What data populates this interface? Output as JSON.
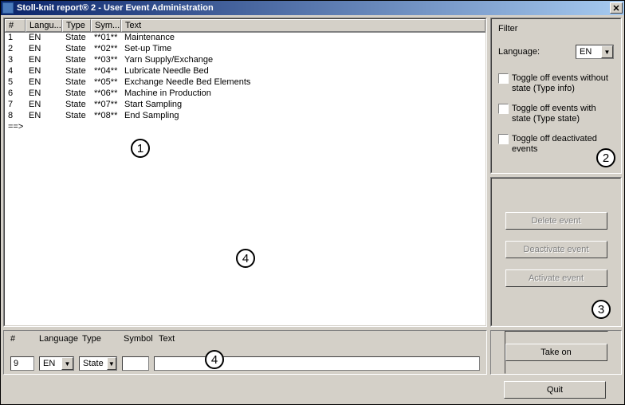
{
  "title": "Stoll-knit report® 2 - User Event Administration",
  "columns": {
    "num": "#",
    "lang": "Langu...",
    "type": "Type",
    "sym": "Sym...",
    "text": "Text"
  },
  "rows": [
    {
      "num": "1",
      "lang": "EN",
      "type": "State",
      "sym": "**01**",
      "text": "Maintenance"
    },
    {
      "num": "2",
      "lang": "EN",
      "type": "State",
      "sym": "**02**",
      "text": "Set-up Time"
    },
    {
      "num": "3",
      "lang": "EN",
      "type": "State",
      "sym": "**03**",
      "text": "Yarn Supply/Exchange"
    },
    {
      "num": "4",
      "lang": "EN",
      "type": "State",
      "sym": "**04**",
      "text": "Lubricate Needle Bed"
    },
    {
      "num": "5",
      "lang": "EN",
      "type": "State",
      "sym": "**05**",
      "text": "Exchange Needle Bed Elements"
    },
    {
      "num": "6",
      "lang": "EN",
      "type": "State",
      "sym": "**06**",
      "text": "Machine in Production"
    },
    {
      "num": "7",
      "lang": "EN",
      "type": "State",
      "sym": "**07**",
      "text": "Start Sampling"
    },
    {
      "num": "8",
      "lang": "EN",
      "type": "State",
      "sym": "**08**",
      "text": "End Sampling"
    }
  ],
  "cursor": "==>",
  "filter": {
    "title": "Filter",
    "language_label": "Language:",
    "language_value": "EN",
    "toggle_without_state": "Toggle off events without state (Type info)",
    "toggle_with_state": "Toggle off events with state (Type state)",
    "toggle_deactivated": "Toggle off deactivated events"
  },
  "buttons": {
    "delete": "Delete event",
    "deactivate": "Deactivate event",
    "activate": "Activate event",
    "takeon": "Take on",
    "quit": "Quit"
  },
  "form": {
    "labels": {
      "num": "#",
      "lang": "Language",
      "type": "Type",
      "sym": "Symbol",
      "text": "Text"
    },
    "values": {
      "num": "9",
      "lang": "EN",
      "type": "State",
      "sym": "",
      "text": ""
    }
  },
  "annotations": {
    "a1": "1",
    "a2": "2",
    "a3": "3",
    "a4": "4"
  }
}
